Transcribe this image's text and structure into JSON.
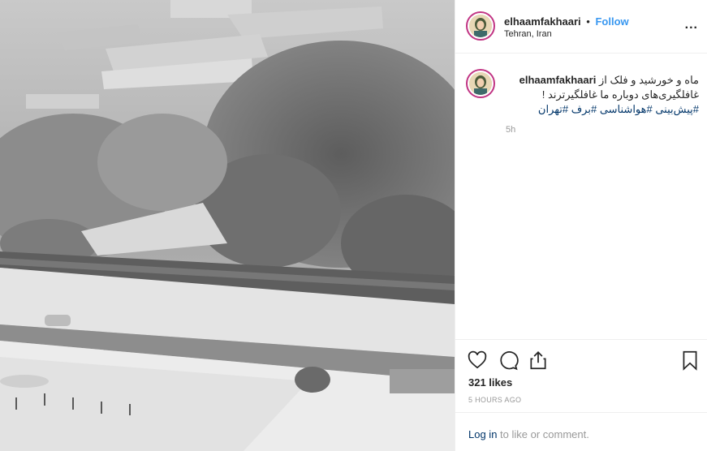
{
  "post": {
    "image_description_icon": "snowy-park-photo",
    "header": {
      "username": "elhaamfakhaari",
      "separator": "•",
      "follow_label": "Follow",
      "location": "Tehran, Iran",
      "more_icon": "ellipsis-icon",
      "more_label": "..."
    },
    "caption": {
      "username": "elhaamfakhaari",
      "line1": "ماه و خورشید و فلک از",
      "line2": "غافلگیری‌های دوباره ما غافلگیرترند !",
      "hashtags": "#پیش‌بینی #هواشناسی #برف #تهران",
      "time": "5h"
    },
    "actions": {
      "like_icon": "heart-icon",
      "comment_icon": "comment-icon",
      "share_icon": "share-icon",
      "save_icon": "bookmark-icon"
    },
    "likes": "321 likes",
    "posted": "5 HOURS AGO",
    "login": {
      "link": "Log in",
      "rest": " to like or comment."
    }
  },
  "colors": {
    "link_blue": "#3897f0",
    "hashtag_blue": "#003569",
    "muted": "#999999",
    "avatar_ring": "#c13584"
  }
}
